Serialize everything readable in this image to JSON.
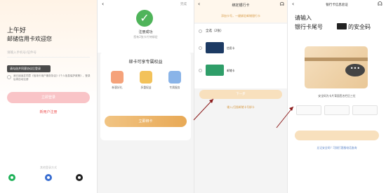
{
  "login": {
    "greeting": "上午好",
    "welcome": "邮储信用卡欢迎您",
    "phone_placeholder": "请输入手机号/证件号",
    "tooltip": "请勾选并同意协议后登录",
    "agreement_text": "我已阅读并同意《信用卡用户服务协议》《个人信息保护政策》，登录后将自动注册",
    "login_button": "立即登录",
    "register_link": "新用户注册",
    "other_login": "其他登录方式"
  },
  "bind_success": {
    "back_icon": "back-arrow-icon",
    "done_label": "完成",
    "status_text": "注册成功",
    "hint_text": "您有2张卡片待绑定",
    "rights_title": "绑卡可享专属权益",
    "benefits": [
      {
        "label": "新客好礼",
        "color": "#f5a27a"
      },
      {
        "label": "多重权益",
        "color": "#f3c25a"
      },
      {
        "label": "专属服务",
        "color": "#8ab4e8"
      }
    ],
    "bind_button": "立即绑卡"
  },
  "bind_card": {
    "title": "绑定银行卡",
    "subtitle": "添加卡号，一键绑定邮储银行卡",
    "select_all": "全选（2张）",
    "cards": [
      {
        "label": "信用卡",
        "color": "#1c3a63"
      },
      {
        "label": "邮储卡",
        "color": "#2f9e69"
      }
    ],
    "next_button": "下一步",
    "manual_link": "输入/扫描邮储卡号绑卡"
  },
  "verify": {
    "nav_title": "银行卡信息验证",
    "heading_line1": "请输入",
    "heading_line2_prefix": "银行卡尾号",
    "heading_line2_suffix": "的安全码",
    "cvv_icon": "dots-icon",
    "description": "安全码为卡片背面签名栏后三位",
    "confirm_button": "确定",
    "help_link": "忘记安全码？可拨打客服电话查询"
  }
}
